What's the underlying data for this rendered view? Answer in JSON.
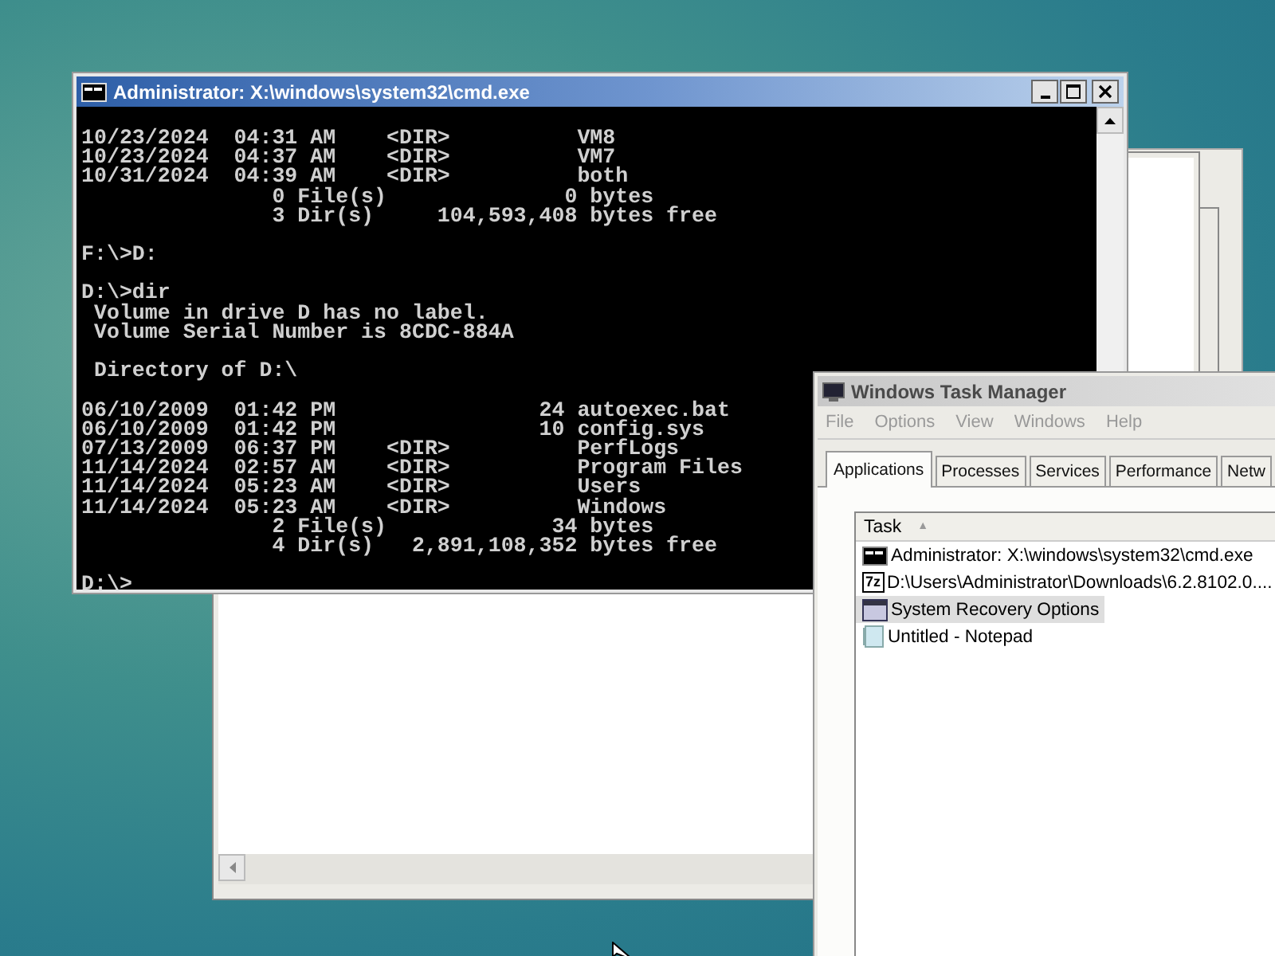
{
  "console_window": {
    "title": "Administrator: X:\\windows\\system32\\cmd.exe",
    "blocks": [
      [
        "10/23/2024  04:31 AM    <DIR>          VM8",
        "10/23/2024  04:37 AM    <DIR>          VM7",
        "10/31/2024  04:39 AM    <DIR>          both",
        "               0 File(s)              0 bytes",
        "               3 Dir(s)     104,593,408 bytes free"
      ],
      [
        "F:\\>D:"
      ],
      [
        "D:\\>dir",
        " Volume in drive D has no label.",
        " Volume Serial Number is 8CDC-884A"
      ],
      [
        " Directory of D:\\"
      ],
      [
        "06/10/2009  01:42 PM                24 autoexec.bat",
        "06/10/2009  01:42 PM                10 config.sys",
        "07/13/2009  06:37 PM    <DIR>          PerfLogs",
        "11/14/2024  02:57 AM    <DIR>          Program Files",
        "11/14/2024  05:23 AM    <DIR>          Users",
        "11/14/2024  05:23 AM    <DIR>          Windows",
        "               2 File(s)             34 bytes",
        "               4 Dir(s)   2,891,108,352 bytes free"
      ],
      [
        "D:\\>"
      ]
    ]
  },
  "task_manager": {
    "title": "Windows Task Manager",
    "menu": [
      "File",
      "Options",
      "View",
      "Windows",
      "Help"
    ],
    "tabs": [
      {
        "label": "Applications",
        "selected": true
      },
      {
        "label": "Processes",
        "selected": false
      },
      {
        "label": "Services",
        "selected": false
      },
      {
        "label": "Performance",
        "selected": false
      },
      {
        "label": "Netw",
        "selected": false
      }
    ],
    "column": "Task",
    "sort_arrow": "▲",
    "rows": [
      {
        "kind": "console",
        "label": "Administrator: X:\\windows\\system32\\cmd.exe",
        "selected": false
      },
      {
        "kind": "archive",
        "icon_label": "7z",
        "label": "D:\\Users\\Administrator\\Downloads\\6.2.8102.0....",
        "selected": false
      },
      {
        "kind": "window",
        "label": "System Recovery Options",
        "selected": true
      },
      {
        "kind": "notepad",
        "label": "Untitled - Notepad",
        "selected": false
      }
    ]
  }
}
